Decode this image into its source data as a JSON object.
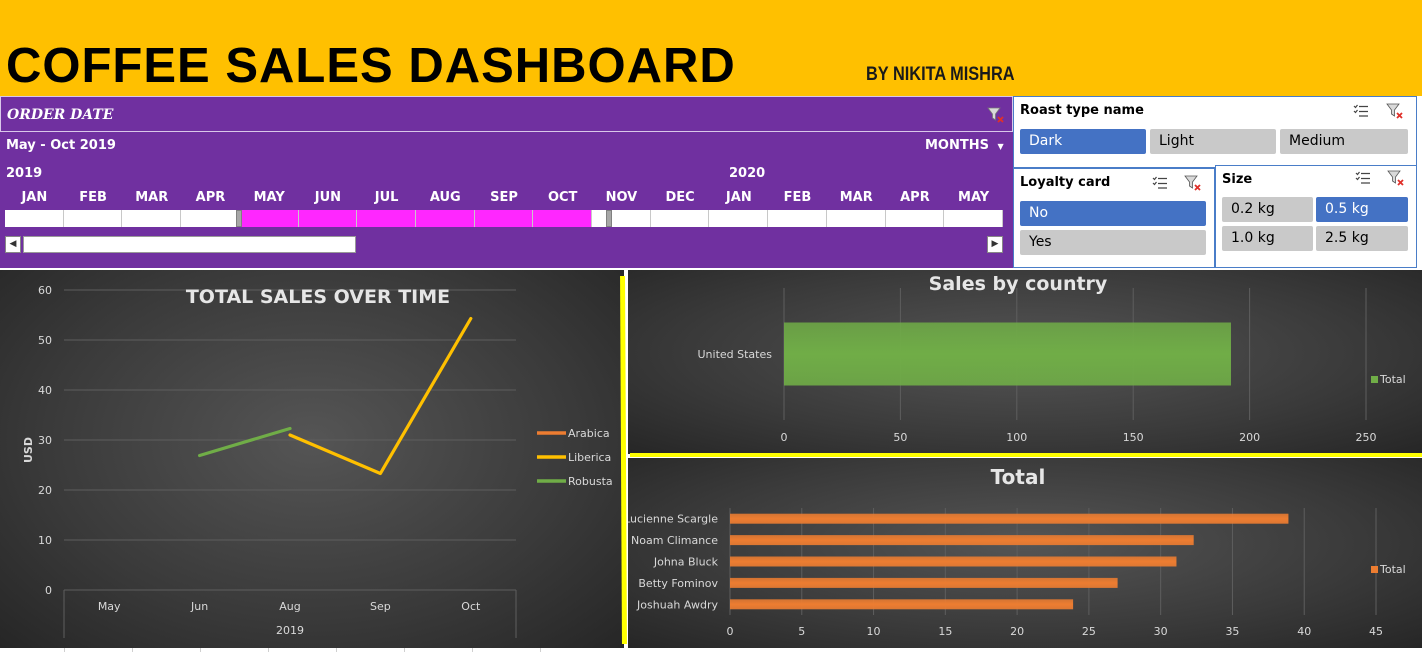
{
  "header": {
    "title": "COFFEE SALES DASHBOARD",
    "byline": "BY NIKITA MISHRA",
    "background": "#ffc000"
  },
  "timeline": {
    "title": "ORDER DATE",
    "range_label": "May - Oct 2019",
    "level_label": "MONTHS",
    "years": [
      "2019",
      "2020"
    ],
    "months": [
      "JAN",
      "FEB",
      "MAR",
      "APR",
      "MAY",
      "JUN",
      "JUL",
      "AUG",
      "SEP",
      "OCT",
      "NOV",
      "DEC",
      "JAN",
      "FEB",
      "MAR",
      "APR",
      "MAY"
    ],
    "selected_months": [
      "MAY",
      "JUN",
      "JUL",
      "AUG",
      "SEP",
      "OCT"
    ],
    "selected_start_index": 4,
    "selected_end_index": 9,
    "background": "#7030a0",
    "selected_color": "#ff27ff"
  },
  "slicers": {
    "roast": {
      "title": "Roast type name",
      "items": [
        "Dark",
        "Light",
        "Medium"
      ],
      "selected": [
        "Dark"
      ]
    },
    "loyalty": {
      "title": "Loyalty card",
      "items": [
        "No",
        "Yes"
      ],
      "selected": [
        "No"
      ]
    },
    "size": {
      "title": "Size",
      "items": [
        "0.2 kg",
        "0.5 kg",
        "1.0 kg",
        "2.5 kg"
      ],
      "selected": [
        "0.5 kg"
      ]
    },
    "active_color": "#4472c4",
    "inactive_color": "#c9c9c9"
  },
  "chart_data": [
    {
      "type": "line",
      "title": "TOTAL SALES OVER TIME",
      "ylabel": "USD",
      "xlabel": "2019",
      "categories": [
        "May",
        "Jun",
        "Aug",
        "Sep",
        "Oct"
      ],
      "ylim": [
        0,
        60
      ],
      "yticks": [
        0,
        10,
        20,
        30,
        40,
        50,
        60
      ],
      "grid": true,
      "legend_position": "right",
      "series": [
        {
          "name": "Arabica",
          "color": "#ed7d31",
          "values": [
            null,
            null,
            null,
            null,
            null
          ]
        },
        {
          "name": "Liberica",
          "color": "#ffc000",
          "values": [
            null,
            null,
            31,
            23.3,
            54.3
          ]
        },
        {
          "name": "Robusta",
          "color": "#70ad47",
          "values": [
            null,
            26.9,
            32.3,
            null,
            null
          ]
        }
      ]
    },
    {
      "type": "bar",
      "orientation": "horizontal",
      "title": "Sales by country",
      "categories": [
        "United States"
      ],
      "xlim": [
        0,
        250
      ],
      "xticks": [
        0,
        50,
        100,
        150,
        200,
        250
      ],
      "grid": true,
      "legend_position": "right",
      "series": [
        {
          "name": "Total",
          "color": "#70ad47",
          "values": [
            192
          ]
        }
      ]
    },
    {
      "type": "bar",
      "orientation": "horizontal",
      "title": "Total",
      "categories": [
        "Lucienne Scargle",
        "Noam Climance",
        "Johna Bluck",
        "Betty Fominov",
        "Joshuah Awdry"
      ],
      "xlim": [
        0,
        45
      ],
      "xticks": [
        0,
        5,
        10,
        15,
        20,
        25,
        30,
        35,
        40,
        45
      ],
      "grid": true,
      "legend_position": "right",
      "series": [
        {
          "name": "Total",
          "color": "#ed7d31",
          "values": [
            38.9,
            32.3,
            31.1,
            27,
            23.9
          ]
        }
      ]
    }
  ]
}
